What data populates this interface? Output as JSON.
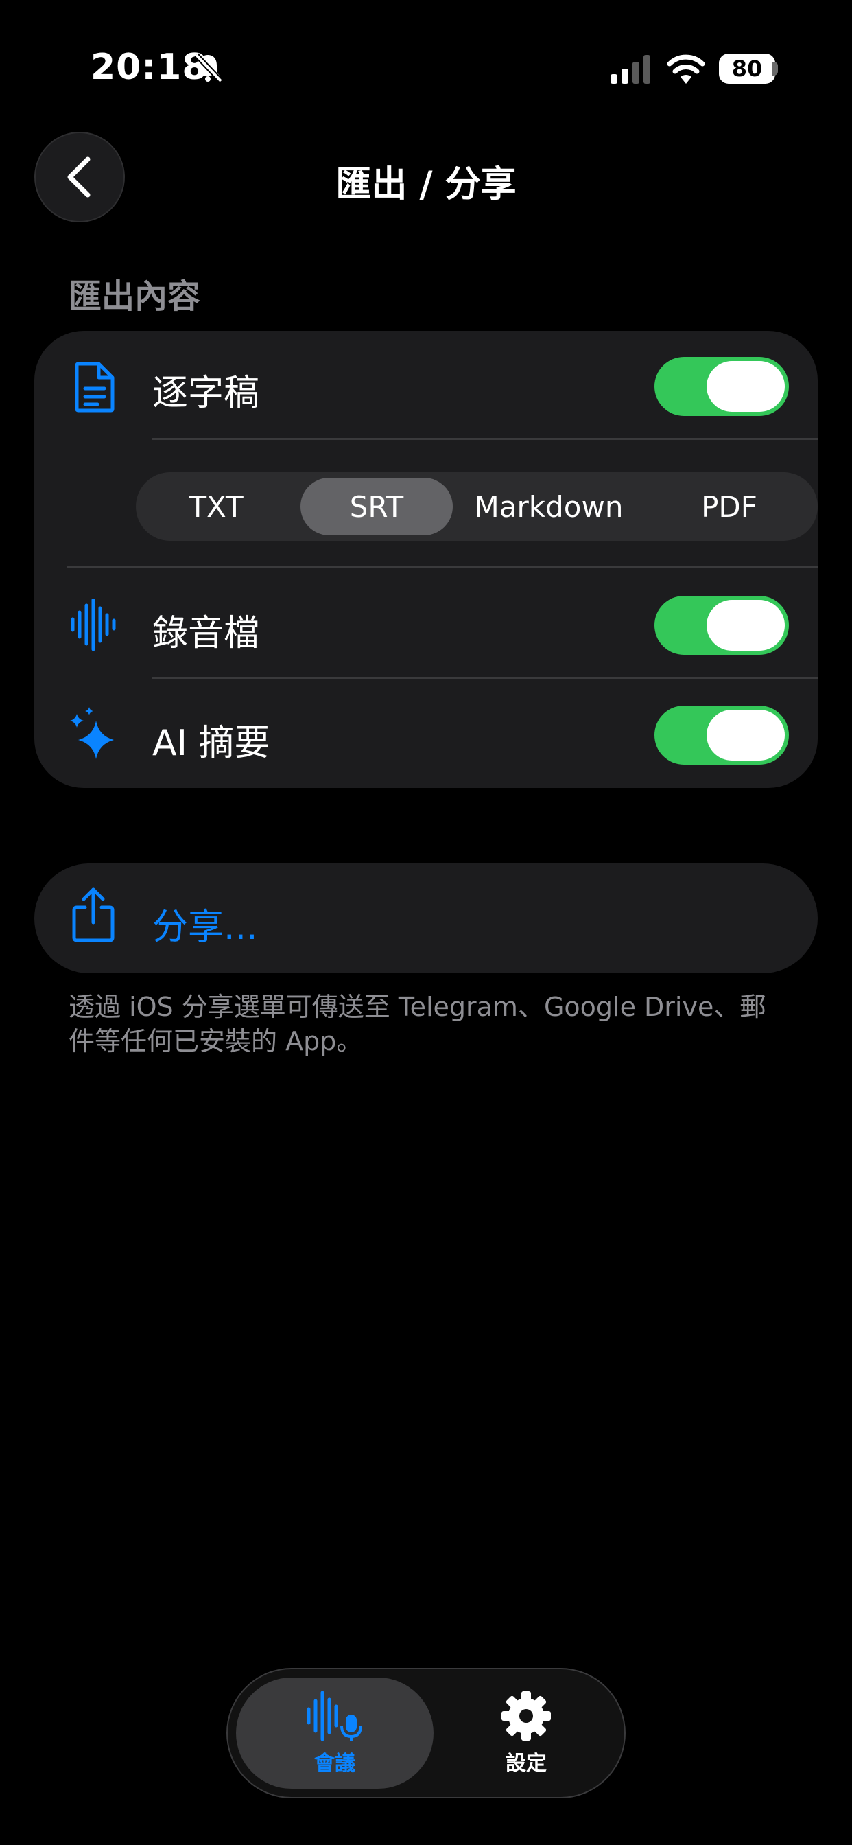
{
  "status_bar": {
    "time": "20:18",
    "battery": "80"
  },
  "nav": {
    "title": "匯出 / 分享"
  },
  "section": {
    "label": "匯出內容"
  },
  "options": {
    "transcript": {
      "label": "逐字稿",
      "enabled": true
    },
    "formats": {
      "items": [
        "TXT",
        "SRT",
        "Markdown",
        "PDF"
      ],
      "selected": "SRT"
    },
    "audio": {
      "label": "錄音檔",
      "enabled": true
    },
    "summary": {
      "label": "AI 摘要",
      "enabled": true
    }
  },
  "share": {
    "label": "分享...",
    "footnote": "透過 iOS 分享選單可傳送至 Telegram、Google Drive、郵件等任何已安裝的 App。"
  },
  "tabbar": {
    "items": [
      {
        "label": "會議",
        "icon": "waveform-mic-icon",
        "active": true
      },
      {
        "label": "設定",
        "icon": "gear-icon",
        "active": false
      }
    ]
  },
  "colors": {
    "accent": "#0a84ff",
    "toggle_on": "#34c759",
    "card": "#1c1c1e",
    "secondary_text": "#8e8e93"
  }
}
